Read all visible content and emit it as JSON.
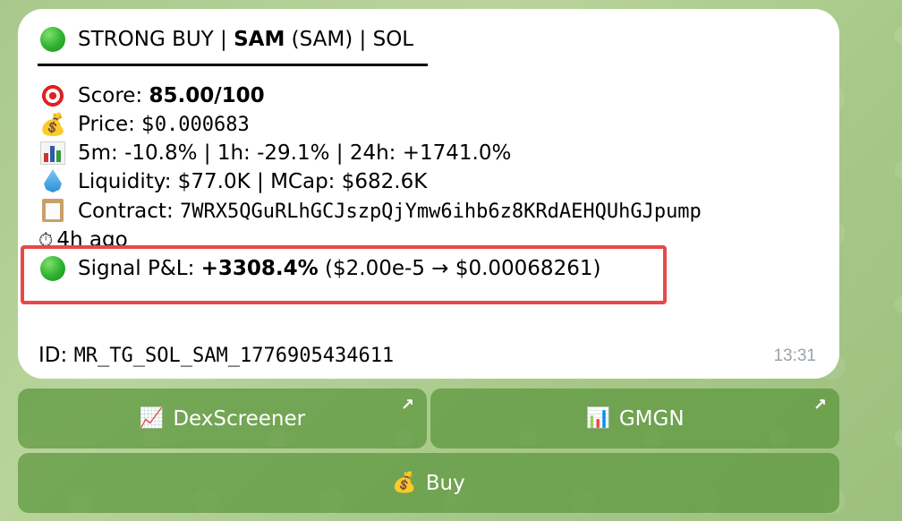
{
  "message": {
    "title_prefix": "STRONG BUY | ",
    "title_token": "SAM",
    "title_suffix": " (SAM) | SOL",
    "score_label": "Score: ",
    "score_value": "85.00/100",
    "price_label": "Price: $",
    "price_value": "0.000683",
    "change_text": "5m: -10.8% | 1h: -29.1% | 24h: +1741.0%",
    "liquidity_text": "Liquidity: $77.0K | MCap: $682.6K",
    "contract_label": "Contract: ",
    "contract_value": "7WRX5QGuRLhGCJszpQjYmw6ihb6z8KRdAEHQUhGJpump",
    "age_text": "4h ago",
    "pnl_label": "Signal P&L: ",
    "pnl_value": "+3308.4%",
    "pnl_detail": " ($2.00e-5 → $0.00068261)",
    "id_label": "ID: ",
    "id_value": "MR_TG_SOL_SAM_1776905434611",
    "timestamp": "13:31"
  },
  "buttons": {
    "dexscreener_label": "DexScreener",
    "gmgn_label": "GMGN",
    "buy_label": "Buy",
    "external_arrow": "↗"
  },
  "icons": {
    "status": "green-circle-icon",
    "score": "target-icon",
    "price": "money-bag-icon",
    "change": "bar-chart-icon",
    "liquidity": "droplet-icon",
    "contract": "clipboard-icon",
    "age": "stopwatch-icon",
    "dexscreener": "chart-increasing-icon",
    "gmgn": "bar-chart-icon",
    "buy": "money-bag-icon"
  },
  "colors": {
    "highlight_border": "#e84848",
    "button_bg": "#5a963c",
    "timestamp": "#9aa3a9"
  }
}
